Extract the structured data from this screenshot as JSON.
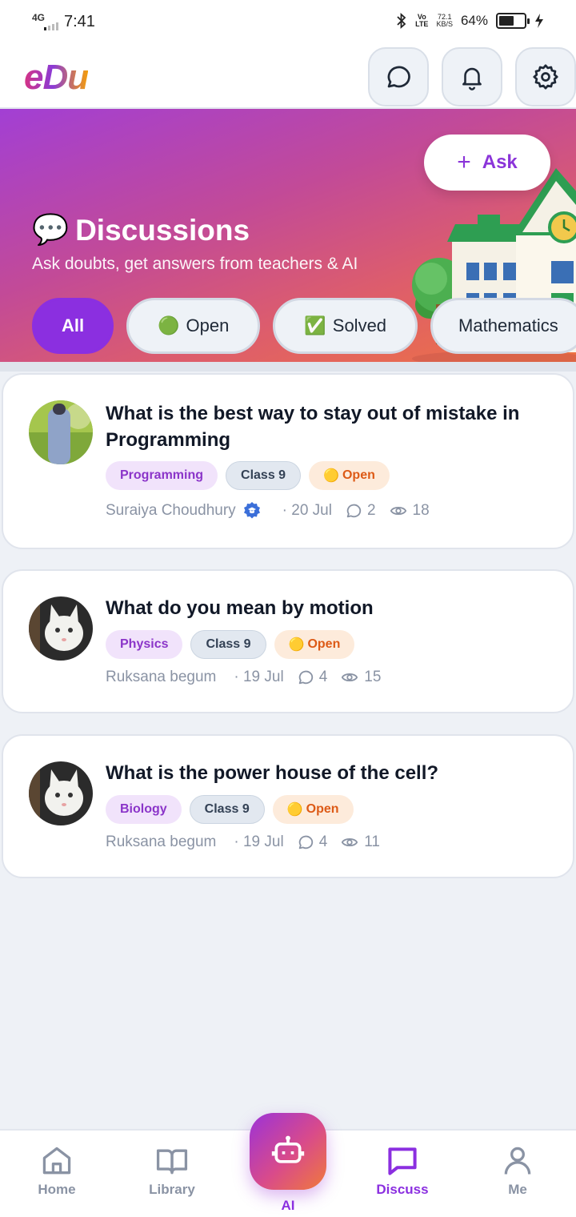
{
  "status_bar": {
    "network": "4G",
    "time": "7:41",
    "lte": "LTE",
    "speed": "72.1",
    "speed_unit": "KB/S",
    "battery": "64%",
    "battery_level": 0.64
  },
  "header": {
    "logo": "eDu",
    "icons": [
      "chat-icon",
      "bell-icon",
      "gear-icon"
    ]
  },
  "hero": {
    "ask_label": "Ask",
    "title_emoji": "💬",
    "title": "Discussions",
    "subtitle": "Ask doubts, get answers from teachers & AI",
    "filters": [
      {
        "label": "All",
        "emoji": ""
      },
      {
        "label": "Open",
        "emoji": "🟢"
      },
      {
        "label": "Solved",
        "emoji": "✅"
      },
      {
        "label": "Mathematics",
        "emoji": ""
      }
    ]
  },
  "questions": [
    {
      "title": "What is the best way to stay out of mistake in Programming",
      "subject": "Programming",
      "class": "Class 9",
      "status_emoji": "🟡",
      "status": "Open",
      "author": "Suraiya Choudhury",
      "date": "· 20 Jul",
      "comments": "2",
      "views": "18"
    },
    {
      "title": "What do you mean by motion",
      "subject": "Physics",
      "class": "Class 9",
      "status_emoji": "🟡",
      "status": "Open",
      "author": "Ruksana begum",
      "date": "· 19 Jul",
      "comments": "4",
      "views": "15"
    },
    {
      "title": "What is the power house of the cell?",
      "subject": "Biology",
      "class": "Class 9",
      "status_emoji": "🟡",
      "status": "Open",
      "author": "Ruksana begum",
      "date": "· 19 Jul",
      "comments": "4",
      "views": "11"
    }
  ],
  "nav": {
    "home": "Home",
    "library": "Library",
    "ai": "AI",
    "discuss": "Discuss",
    "me": "Me",
    "active": "Discuss"
  },
  "colors": {
    "accent": "#8b2fe0",
    "open": "#dd5a16",
    "muted": "#8a93a4"
  }
}
